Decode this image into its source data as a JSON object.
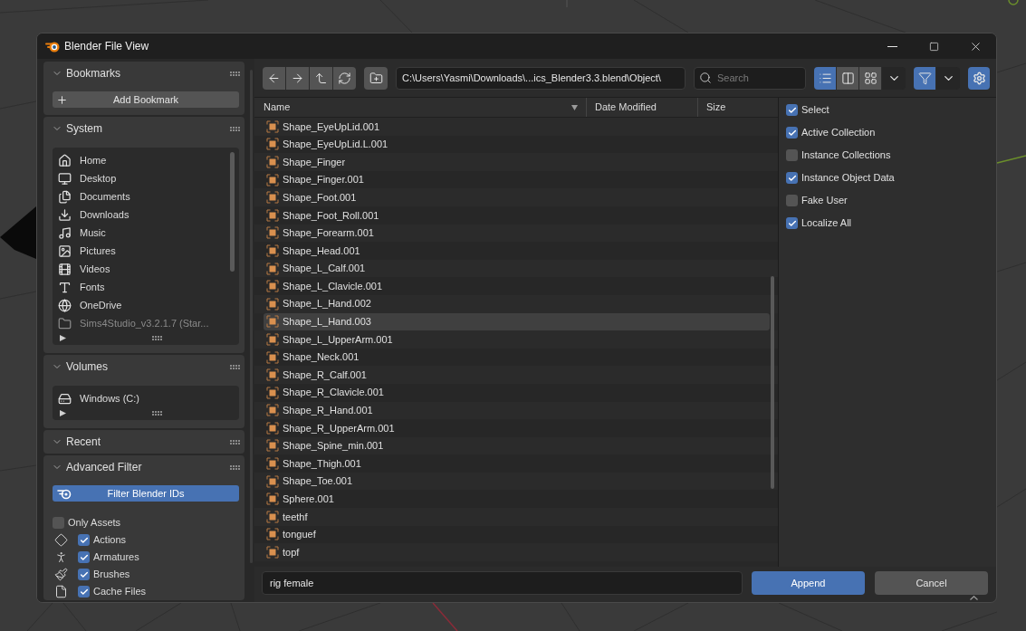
{
  "window": {
    "title": "Blender File View"
  },
  "sidebar": {
    "panels": [
      {
        "kind": "bookmarks",
        "title": "Bookmarks",
        "expanded": true,
        "button": "Add Bookmark"
      },
      {
        "kind": "system",
        "title": "System",
        "expanded": true,
        "items": [
          {
            "label": "Home",
            "disabled": false
          },
          {
            "label": "Desktop",
            "disabled": false
          },
          {
            "label": "Documents",
            "disabled": false
          },
          {
            "label": "Downloads",
            "disabled": false
          },
          {
            "label": "Music",
            "disabled": false
          },
          {
            "label": "Pictures",
            "disabled": false
          },
          {
            "label": "Videos",
            "disabled": false
          },
          {
            "label": "Fonts",
            "disabled": false
          },
          {
            "label": "OneDrive",
            "disabled": false
          },
          {
            "label": "Sims4Studio_v3.2.1.7 (Star...",
            "disabled": true
          }
        ]
      },
      {
        "kind": "volumes",
        "title": "Volumes",
        "expanded": true,
        "items": [
          {
            "label": "Windows (C:)",
            "disabled": false
          }
        ]
      },
      {
        "kind": "recent",
        "title": "Recent",
        "expanded": true
      },
      {
        "kind": "filter",
        "title": "Advanced Filter",
        "expanded": true,
        "toggle": {
          "label": "Filter Blender IDs",
          "on": true
        },
        "options": [
          {
            "kind": "assets",
            "label": "Only Assets",
            "checked": false
          },
          {
            "kind": "id_type",
            "label": "Actions",
            "checked": true
          },
          {
            "kind": "id_type",
            "label": "Armatures",
            "checked": true
          },
          {
            "kind": "id_type",
            "label": "Brushes",
            "checked": true
          },
          {
            "kind": "id_type",
            "label": "Cache Files",
            "checked": true
          }
        ]
      }
    ]
  },
  "toolbar": {
    "path": "C:\\Users\\Yasmi\\Downloads\\...ics_Blender3.3.blend\\Object\\",
    "search": {
      "placeholder": "Search"
    },
    "display_modes": [
      {
        "selected": true
      },
      {
        "selected": false
      },
      {
        "selected": false
      }
    ],
    "filter": {
      "on": true
    },
    "settings": {
      "on": true
    }
  },
  "file_list": {
    "columns": [
      {
        "label": "Name",
        "sorted": true
      },
      {
        "label": "Date Modified",
        "sorted": false
      },
      {
        "label": "Size",
        "sorted": false
      }
    ],
    "rows": [
      {
        "name": "Shape_EyeUpLid.001",
        "selected": false
      },
      {
        "name": "Shape_EyeUpLid.L.001",
        "selected": false
      },
      {
        "name": "Shape_Finger",
        "selected": false
      },
      {
        "name": "Shape_Finger.001",
        "selected": false
      },
      {
        "name": "Shape_Foot.001",
        "selected": false
      },
      {
        "name": "Shape_Foot_Roll.001",
        "selected": false
      },
      {
        "name": "Shape_Forearm.001",
        "selected": false
      },
      {
        "name": "Shape_Head.001",
        "selected": false
      },
      {
        "name": "Shape_L_Calf.001",
        "selected": false
      },
      {
        "name": "Shape_L_Clavicle.001",
        "selected": false
      },
      {
        "name": "Shape_L_Hand.002",
        "selected": false
      },
      {
        "name": "Shape_L_Hand.003",
        "selected": true
      },
      {
        "name": "Shape_L_UpperArm.001",
        "selected": false
      },
      {
        "name": "Shape_Neck.001",
        "selected": false
      },
      {
        "name": "Shape_R_Calf.001",
        "selected": false
      },
      {
        "name": "Shape_R_Clavicle.001",
        "selected": false
      },
      {
        "name": "Shape_R_Hand.001",
        "selected": false
      },
      {
        "name": "Shape_R_UpperArm.001",
        "selected": false
      },
      {
        "name": "Shape_Spine_min.001",
        "selected": false
      },
      {
        "name": "Shape_Thigh.001",
        "selected": false
      },
      {
        "name": "Shape_Toe.001",
        "selected": false
      },
      {
        "name": "Sphere.001",
        "selected": false
      },
      {
        "name": "teethf",
        "selected": false
      },
      {
        "name": "tonguef",
        "selected": false
      },
      {
        "name": "topf",
        "selected": false
      }
    ]
  },
  "options": [
    {
      "label": "Select",
      "checked": true
    },
    {
      "label": "Active Collection",
      "checked": true
    },
    {
      "label": "Instance Collections",
      "checked": false
    },
    {
      "label": "Instance Object Data",
      "checked": true
    },
    {
      "label": "Fake User",
      "checked": false
    },
    {
      "label": "Localize All",
      "checked": true
    }
  ],
  "footer": {
    "filename": "rig female",
    "buttons": [
      {
        "label": "Append",
        "kind": "primary"
      },
      {
        "label": "Cancel",
        "kind": "secondary"
      }
    ]
  }
}
